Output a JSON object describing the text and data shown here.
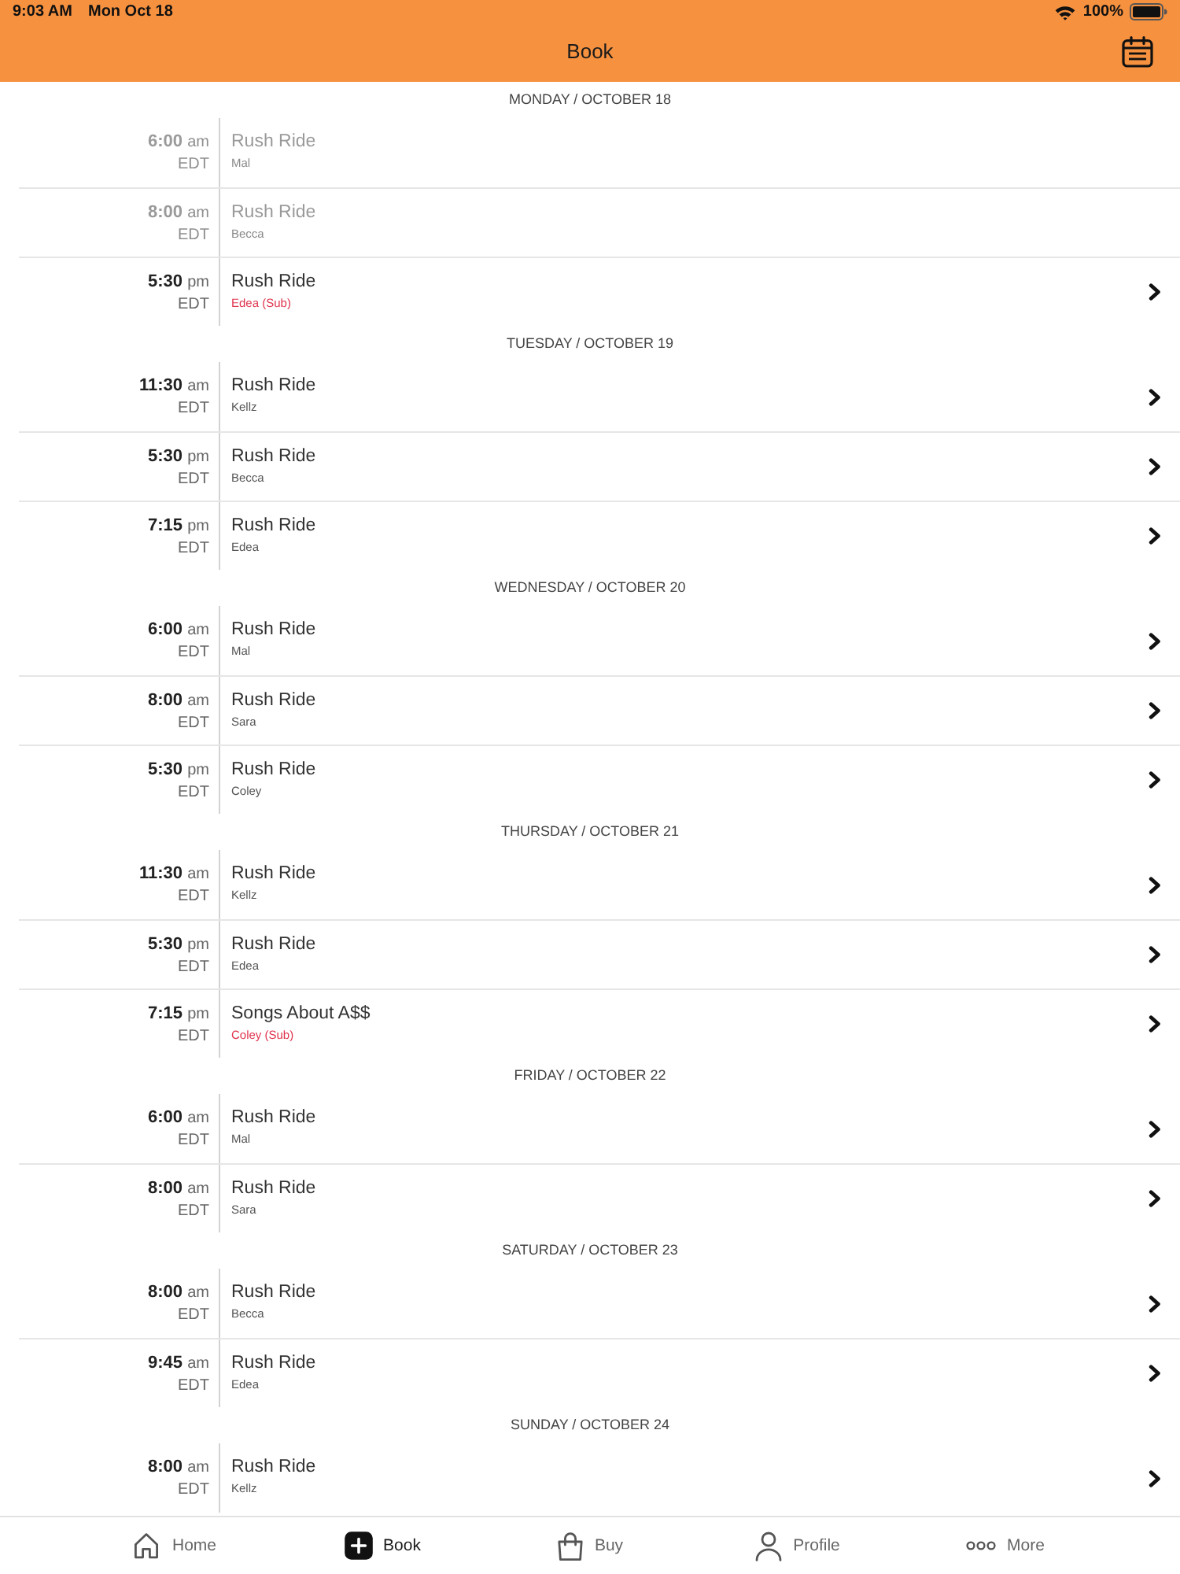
{
  "status_bar": {
    "time": "9:03 AM",
    "date": "Mon Oct 18",
    "battery_percent": "100%"
  },
  "nav_bar": {
    "title": "Book"
  },
  "days": [
    {
      "label": "MONDAY / OCTOBER 18",
      "classes": [
        {
          "time": "6:00",
          "meridiem": "am",
          "zone": "EDT",
          "title": "Rush Ride",
          "instructor": "Mal",
          "substitute": false,
          "disabled": true
        },
        {
          "time": "8:00",
          "meridiem": "am",
          "zone": "EDT",
          "title": "Rush Ride",
          "instructor": "Becca",
          "substitute": false,
          "disabled": true
        },
        {
          "time": "5:30",
          "meridiem": "pm",
          "zone": "EDT",
          "title": "Rush Ride",
          "instructor": "Edea (Sub)",
          "substitute": true,
          "disabled": false
        }
      ]
    },
    {
      "label": "TUESDAY / OCTOBER 19",
      "classes": [
        {
          "time": "11:30",
          "meridiem": "am",
          "zone": "EDT",
          "title": "Rush Ride",
          "instructor": "Kellz",
          "substitute": false,
          "disabled": false
        },
        {
          "time": "5:30",
          "meridiem": "pm",
          "zone": "EDT",
          "title": "Rush Ride",
          "instructor": "Becca",
          "substitute": false,
          "disabled": false
        },
        {
          "time": "7:15",
          "meridiem": "pm",
          "zone": "EDT",
          "title": "Rush Ride",
          "instructor": "Edea",
          "substitute": false,
          "disabled": false
        }
      ]
    },
    {
      "label": "WEDNESDAY / OCTOBER 20",
      "classes": [
        {
          "time": "6:00",
          "meridiem": "am",
          "zone": "EDT",
          "title": "Rush Ride",
          "instructor": "Mal",
          "substitute": false,
          "disabled": false
        },
        {
          "time": "8:00",
          "meridiem": "am",
          "zone": "EDT",
          "title": "Rush Ride",
          "instructor": "Sara",
          "substitute": false,
          "disabled": false
        },
        {
          "time": "5:30",
          "meridiem": "pm",
          "zone": "EDT",
          "title": "Rush Ride",
          "instructor": "Coley",
          "substitute": false,
          "disabled": false
        }
      ]
    },
    {
      "label": "THURSDAY / OCTOBER 21",
      "classes": [
        {
          "time": "11:30",
          "meridiem": "am",
          "zone": "EDT",
          "title": "Rush Ride",
          "instructor": "Kellz",
          "substitute": false,
          "disabled": false
        },
        {
          "time": "5:30",
          "meridiem": "pm",
          "zone": "EDT",
          "title": "Rush Ride",
          "instructor": "Edea",
          "substitute": false,
          "disabled": false
        },
        {
          "time": "7:15",
          "meridiem": "pm",
          "zone": "EDT",
          "title": "Songs About A$$",
          "instructor": "Coley (Sub)",
          "substitute": true,
          "disabled": false
        }
      ]
    },
    {
      "label": "FRIDAY / OCTOBER 22",
      "classes": [
        {
          "time": "6:00",
          "meridiem": "am",
          "zone": "EDT",
          "title": "Rush Ride",
          "instructor": "Mal",
          "substitute": false,
          "disabled": false
        },
        {
          "time": "8:00",
          "meridiem": "am",
          "zone": "EDT",
          "title": "Rush Ride",
          "instructor": "Sara",
          "substitute": false,
          "disabled": false
        }
      ]
    },
    {
      "label": "SATURDAY / OCTOBER 23",
      "classes": [
        {
          "time": "8:00",
          "meridiem": "am",
          "zone": "EDT",
          "title": "Rush Ride",
          "instructor": "Becca",
          "substitute": false,
          "disabled": false
        },
        {
          "time": "9:45",
          "meridiem": "am",
          "zone": "EDT",
          "title": "Rush Ride",
          "instructor": "Edea",
          "substitute": false,
          "disabled": false
        }
      ]
    },
    {
      "label": "SUNDAY / OCTOBER 24",
      "classes": [
        {
          "time": "8:00",
          "meridiem": "am",
          "zone": "EDT",
          "title": "Rush Ride",
          "instructor": "Kellz",
          "substitute": false,
          "disabled": false
        }
      ]
    }
  ],
  "tab_bar": [
    {
      "label": "Home",
      "selected": false
    },
    {
      "label": "Book",
      "selected": true
    },
    {
      "label": "Buy",
      "selected": false
    },
    {
      "label": "Profile",
      "selected": false
    },
    {
      "label": "More",
      "selected": false
    }
  ]
}
